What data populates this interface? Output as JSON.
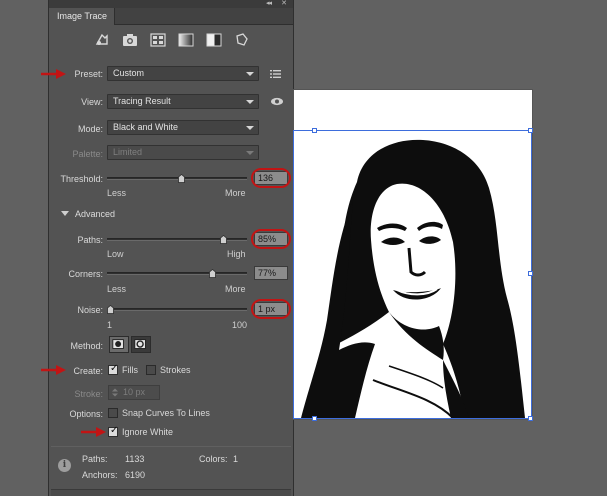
{
  "panel": {
    "tab_label": "Image Trace",
    "preset_icons": [
      "auto-color-icon",
      "high-color-icon",
      "low-color-icon",
      "grayscale-icon",
      "black-and-white-icon",
      "outline-icon"
    ]
  },
  "preset": {
    "label": "Preset:",
    "value": "Custom"
  },
  "view": {
    "label": "View:",
    "value": "Tracing Result"
  },
  "mode": {
    "label": "Mode:",
    "value": "Black and White"
  },
  "palette": {
    "label": "Palette:",
    "value": "Limited"
  },
  "threshold": {
    "label": "Threshold:",
    "value": "136",
    "level": 136,
    "min": 1,
    "max": 255,
    "low_label": "Less",
    "high_label": "More"
  },
  "advanced": {
    "label": "Advanced"
  },
  "paths": {
    "label": "Paths:",
    "value": "85%",
    "level": 0.85,
    "low_label": "Low",
    "high_label": "High"
  },
  "corners": {
    "label": "Corners:",
    "value": "77%",
    "level": 0.77,
    "low_label": "Less",
    "high_label": "More"
  },
  "noise": {
    "label": "Noise:",
    "value": "1 px",
    "level": 1,
    "min": 1,
    "max": 100,
    "low_label": "1",
    "high_label": "100"
  },
  "method": {
    "label": "Method:",
    "selected": "overlapping",
    "buttons": [
      "abutting-method-icon",
      "overlapping-method-icon"
    ]
  },
  "create": {
    "label": "Create:",
    "fills_label": "Fills",
    "fills_checked": true,
    "strokes_label": "Strokes",
    "strokes_checked": false
  },
  "stroke": {
    "label": "Stroke:",
    "value": "10 px"
  },
  "options": {
    "label": "Options:",
    "snap_label": "Snap Curves To Lines",
    "snap_checked": false,
    "ignore_white_label": "Ignore White",
    "ignore_white_checked": true
  },
  "stats": {
    "paths_label": "Paths:",
    "paths_value": "1133",
    "colors_label": "Colors:",
    "colors_value": "1",
    "anchors_label": "Anchors:",
    "anchors_value": "6190"
  },
  "colors": {
    "annotation_red": "#c21414",
    "selection_blue": "#3d6ddc",
    "panel_bg": "#535353"
  }
}
